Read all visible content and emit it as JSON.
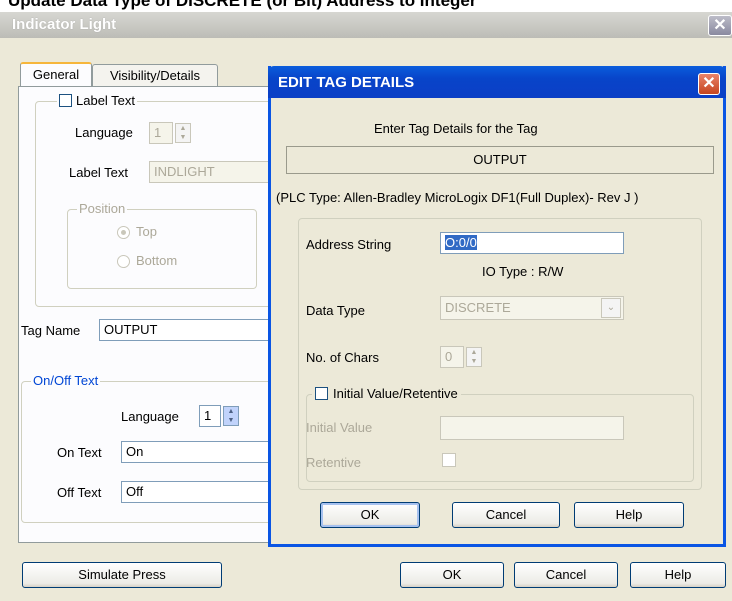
{
  "top_strip": {
    "text": "Update Data Type of DISCRETE (or Bit) Address to Integer"
  },
  "outer_dialog": {
    "title": "Indicator Light",
    "tabs": [
      {
        "label": "General"
      },
      {
        "label": "Visibility/Details"
      }
    ],
    "label_text_group": {
      "checkbox_label": "Label Text",
      "language_label": "Language",
      "language_value": "1",
      "label_text_label": "Label Text",
      "label_text_value": "INDLIGHT",
      "position_legend": "Position",
      "position_top": "Top",
      "position_bottom": "Bottom"
    },
    "tag_name_label": "Tag Name",
    "tag_name_value": "OUTPUT",
    "onoff_group": {
      "legend": "On/Off Text",
      "language_label": "Language",
      "language_value": "1",
      "on_text_label": "On Text",
      "on_text_value": "On",
      "off_text_label": "Off Text",
      "off_text_value": "Off"
    },
    "buttons": {
      "simulate": "Simulate Press",
      "ok": "OK",
      "cancel": "Cancel",
      "help": "Help"
    }
  },
  "inner_dialog": {
    "title": "EDIT TAG DETAILS",
    "prompt": "Enter Tag Details for the Tag",
    "tag_name": "OUTPUT",
    "plc_type": "(PLC Type:  Allen-Bradley MicroLogix DF1(Full Duplex)- Rev J )",
    "address_label": "Address String",
    "address_value": "O:0/0",
    "io_type": "IO Type : R/W",
    "data_type_label": "Data Type",
    "data_type_value": "DISCRETE",
    "chars_label": "No. of Chars",
    "chars_value": "0",
    "initial_retentive_label": "Initial Value/Retentive",
    "initial_value_label": "Initial Value",
    "retentive_label": "Retentive",
    "buttons": {
      "ok": "OK",
      "cancel": "Cancel",
      "help": "Help"
    }
  },
  "colors": {
    "titlebar_blue": "#0a55e4",
    "dialog_bg": "#ece9d8",
    "close_red": "#c6451f"
  },
  "icons": [
    "close-icon",
    "spin-up-icon",
    "spin-down-icon",
    "chevron-down-icon"
  ]
}
